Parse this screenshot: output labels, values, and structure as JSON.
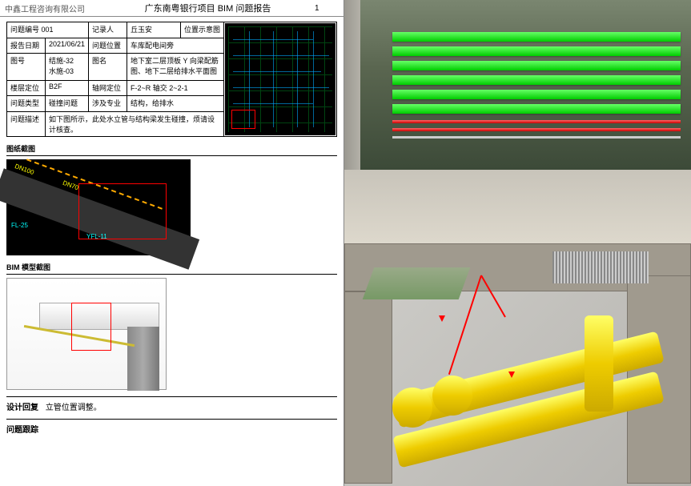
{
  "header": {
    "company": "中鑫工程咨询有限公司",
    "title": "广东南粤银行项目 BIM 问题报告",
    "page": "1"
  },
  "table": {
    "issue_no_lab": "问题编号 001",
    "recorder_lab": "记录人",
    "recorder_val": "丘玉安",
    "locfig_lab": "位置示意图",
    "date_lab": "报告日期",
    "date_val": "2021/06/21",
    "issuepos_lab": "问题位置",
    "issuepos_val": "车库配电间旁",
    "dwgno_lab": "图号",
    "dwgno_val": "结施-32\n水施-03",
    "dwgname_lab": "图名",
    "dwgname_val": "地下室二层顶板 Y 向梁配筋图、地下二层给排水平面图",
    "floor_lab": "楼层定位",
    "floor_val": "B2F",
    "grid_lab": "轴网定位",
    "grid_val": "F-2~R 轴交 2~2-1",
    "type_lab": "问题类型",
    "type_val": "碰撞问题",
    "disc_lab": "涉及专业",
    "disc_val": "结构，给排水",
    "desc_lab": "问题描述",
    "desc_val": "如下图所示，此处水立管与结构梁发生碰撞，烦请设计核查。"
  },
  "sections": {
    "fig1": "图纸截图",
    "fig2": "BIM 模型截图",
    "reply_lab": "设计回复",
    "reply_val": "立管位置调整。",
    "track_lab": "问题跟踪"
  },
  "annot": {
    "fl": "FL-25",
    "yfl": "YFL-11",
    "dn1": "DN100",
    "dn2": "DN70"
  }
}
